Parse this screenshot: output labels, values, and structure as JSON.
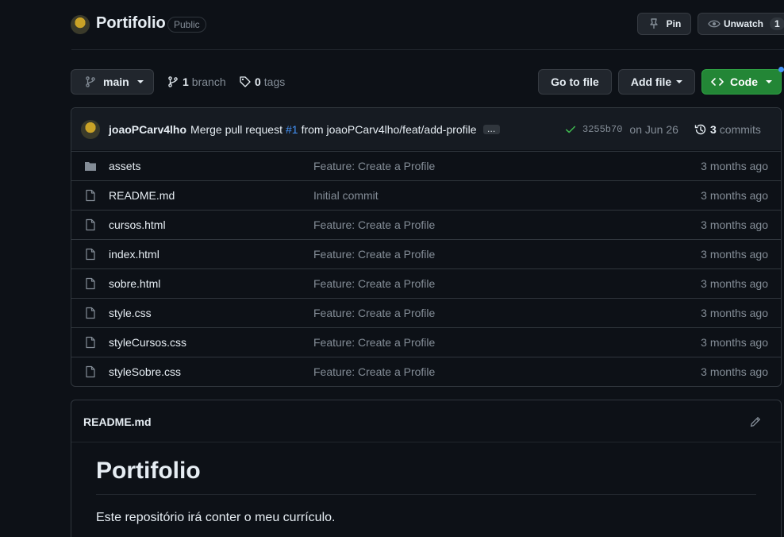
{
  "repo": {
    "name": "Portifolio",
    "visibility": "Public"
  },
  "header_actions": {
    "pin_label": "Pin",
    "unwatch_label": "Unwatch",
    "unwatch_count": "1"
  },
  "toolbar": {
    "branch_name": "main",
    "branch_count": "1",
    "branch_word": "branch",
    "tag_count": "0",
    "tag_word": "tags",
    "go_to_file": "Go to file",
    "add_file": "Add file",
    "code": "Code"
  },
  "latest_commit": {
    "author": "joaoPCarv4lho",
    "message_prefix": "Merge pull request",
    "pr_link": "#1",
    "message_suffix": "from joaoPCarv4lho/feat/add-profile",
    "ellipsis": "…",
    "sha": "3255b70",
    "date": "on Jun 26",
    "commit_count": "3",
    "commit_word": "commits"
  },
  "files": [
    {
      "name": "assets",
      "type": "folder",
      "message": "Feature: Create a Profile",
      "age": "3 months ago"
    },
    {
      "name": "README.md",
      "type": "file",
      "message": "Initial commit",
      "age": "3 months ago"
    },
    {
      "name": "cursos.html",
      "type": "file",
      "message": "Feature: Create a Profile",
      "age": "3 months ago"
    },
    {
      "name": "index.html",
      "type": "file",
      "message": "Feature: Create a Profile",
      "age": "3 months ago"
    },
    {
      "name": "sobre.html",
      "type": "file",
      "message": "Feature: Create a Profile",
      "age": "3 months ago"
    },
    {
      "name": "style.css",
      "type": "file",
      "message": "Feature: Create a Profile",
      "age": "3 months ago"
    },
    {
      "name": "styleCursos.css",
      "type": "file",
      "message": "Feature: Create a Profile",
      "age": "3 months ago"
    },
    {
      "name": "styleSobre.css",
      "type": "file",
      "message": "Feature: Create a Profile",
      "age": "3 months ago"
    }
  ],
  "readme": {
    "filename": "README.md",
    "heading": "Portifolio",
    "body": "Este repositório irá conter o meu currículo."
  },
  "colors": {
    "background": "#0d1117",
    "border": "#30363d",
    "code_button": "#238636",
    "link": "#4493f8",
    "success": "#3fb950"
  }
}
